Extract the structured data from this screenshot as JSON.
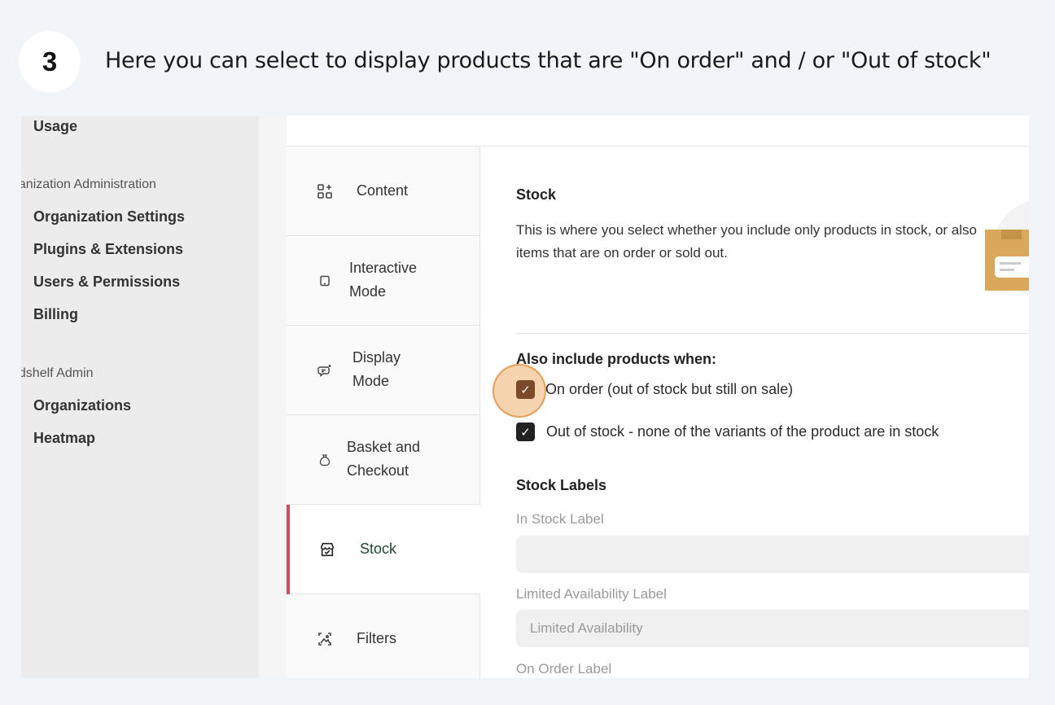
{
  "step": {
    "number": "3",
    "instruction": "Here you can select to display products that are \"On order\" and / or \"Out of stock\""
  },
  "sidebar": {
    "usage": "Usage",
    "org_admin_heading": "ganization Administration",
    "org_admin_items": [
      "Organization Settings",
      "Plugins & Extensions",
      "Users & Permissions",
      "Billing"
    ],
    "cloudshelf_heading": "udshelf Admin",
    "cloudshelf_items": [
      "Organizations",
      "Heatmap"
    ]
  },
  "tabs": [
    {
      "label_1": "Content",
      "label_2": "",
      "icon": "content-blocks-icon"
    },
    {
      "label_1": "Interactive",
      "label_2": "Mode",
      "icon": "tablet-icon"
    },
    {
      "label_1": "Display",
      "label_2": "Mode",
      "icon": "chat-sparkle-icon"
    },
    {
      "label_1": "Basket and",
      "label_2": "Checkout",
      "icon": "money-bag-icon"
    },
    {
      "label_1": "Stock",
      "label_2": "",
      "icon": "store-check-icon"
    },
    {
      "label_1": "Filters",
      "label_2": "",
      "icon": "image-filter-icon"
    }
  ],
  "active_tab": "Stock",
  "stock": {
    "title": "Stock",
    "description": "This is where you select whether you include only products in stock, or also items that are on order or sold out.",
    "also_include_title": "Also include products when:",
    "options": [
      {
        "label": "On order (out of stock but still on sale)",
        "checked": true
      },
      {
        "label": "Out of stock - none of the variants of the product are in stock",
        "checked": true
      }
    ],
    "labels_title": "Stock Labels",
    "in_stock_label": "In Stock Label",
    "in_stock_value": "",
    "limited_label": "Limited Availability Label",
    "limited_placeholder": "Limited Availability",
    "on_order_label": "On Order Label"
  },
  "colors": {
    "active_tab_indicator": "#d9475a",
    "highlight_ring": "#eca050",
    "checkbox_dark": "#222222",
    "checkbox_highlighted": "#7a4a2a"
  }
}
